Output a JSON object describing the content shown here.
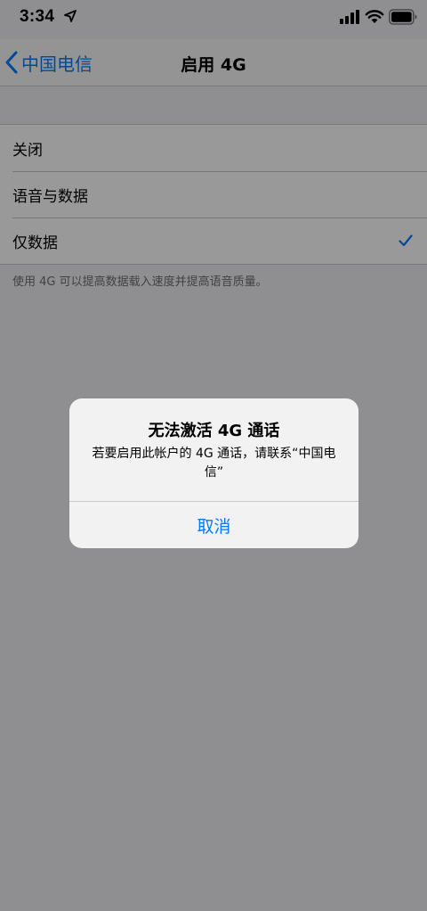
{
  "status_bar": {
    "time": "3:34"
  },
  "nav": {
    "back_label": "中国电信",
    "title": "启用 4G"
  },
  "options": [
    {
      "label": "关闭",
      "selected": false
    },
    {
      "label": "语音与数据",
      "selected": false
    },
    {
      "label": "仅数据",
      "selected": true
    }
  ],
  "footer_note": "使用 4G 可以提高数据载入速度并提高语音质量。",
  "alert": {
    "title": "无法激活 4G 通话",
    "message": "若要启用此帐户的 4G 通话，请联系“中国电信”",
    "cancel_label": "取消"
  },
  "colors": {
    "accent": "#007aff",
    "background": "#efeff4",
    "overlay": "rgba(0,0,0,0.4)"
  },
  "icons": [
    "location-arrow-icon",
    "cellular-signal-icon",
    "wifi-icon",
    "battery-icon",
    "chevron-left-icon",
    "checkmark-icon"
  ]
}
